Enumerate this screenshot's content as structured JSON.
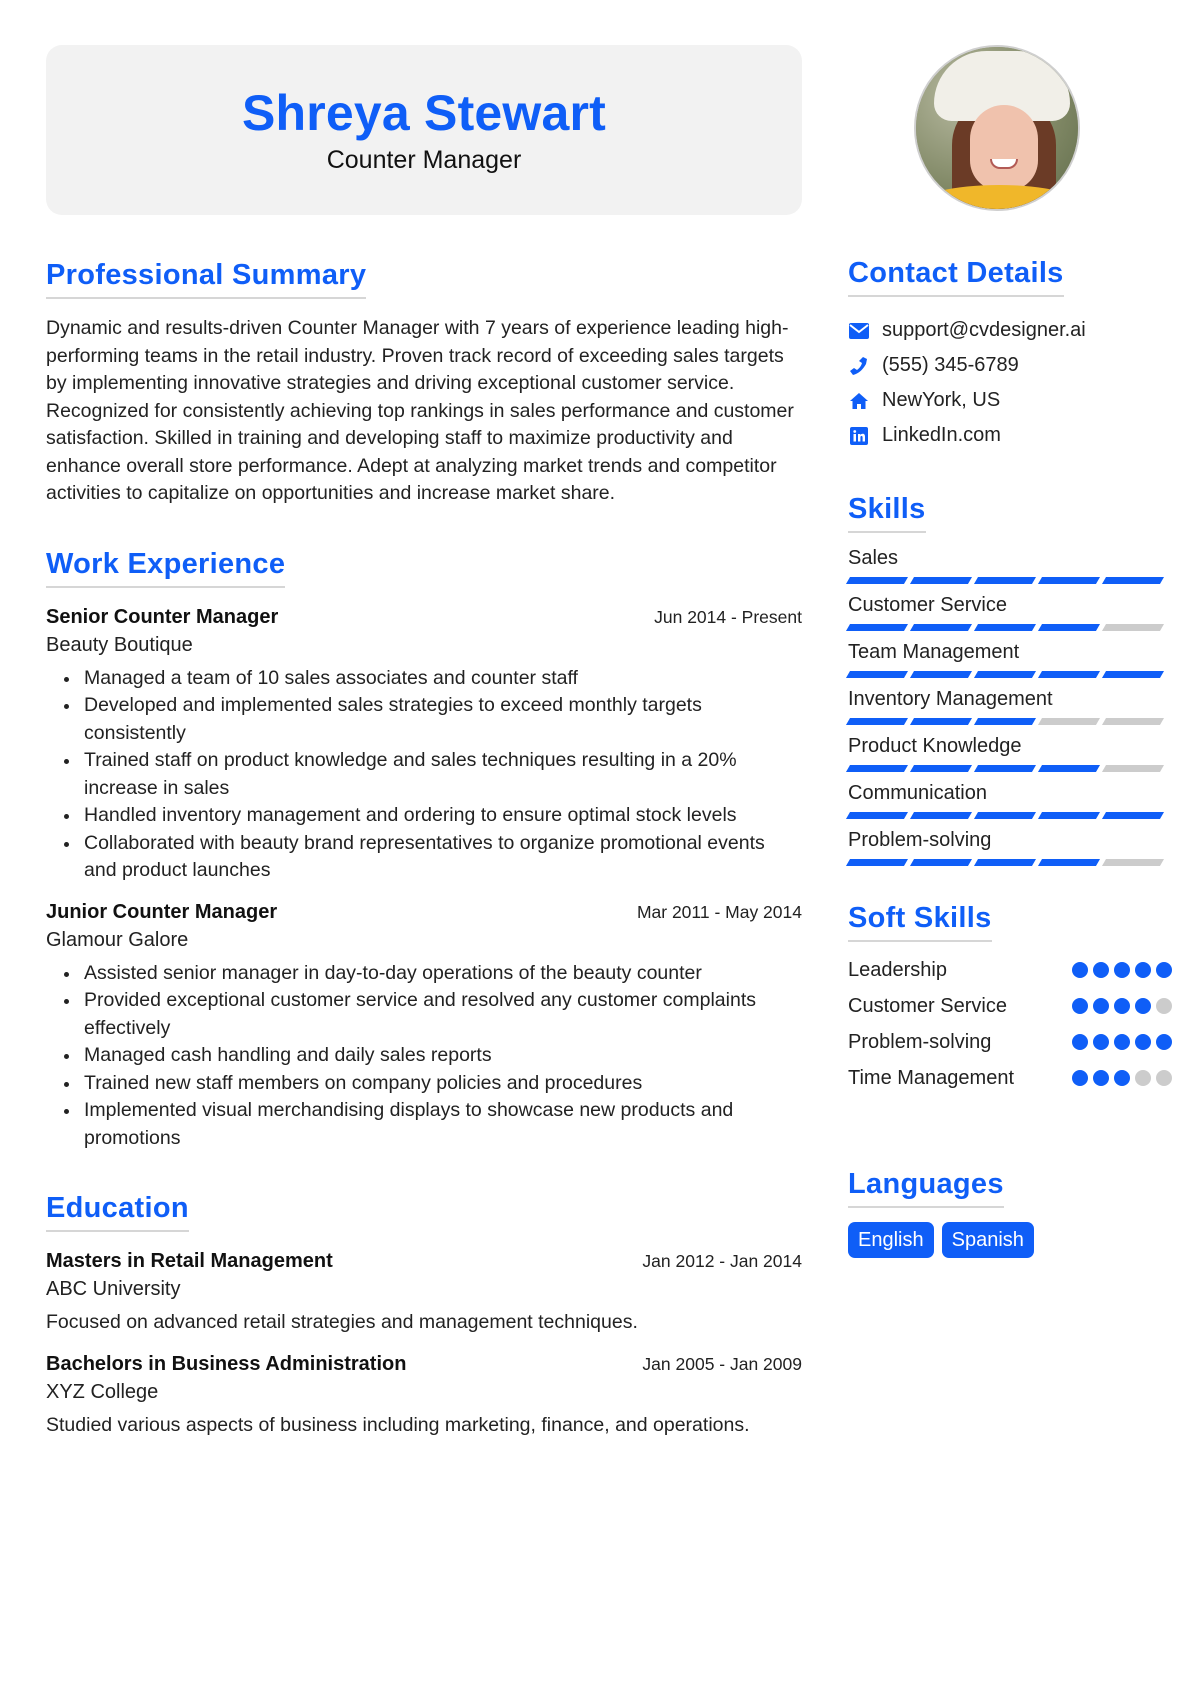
{
  "header": {
    "name": "Shreya Stewart",
    "title": "Counter Manager"
  },
  "summary": {
    "heading": "Professional Summary",
    "text": "Dynamic and results-driven Counter Manager with 7 years of experience leading high-performing teams in the retail industry. Proven track record of exceeding sales targets by implementing innovative strategies and driving exceptional customer service. Recognized for consistently achieving top rankings in sales performance and customer satisfaction. Skilled in training and developing staff to maximize productivity and enhance overall store performance. Adept at analyzing market trends and competitor activities to capitalize on opportunities and increase market share."
  },
  "experience": {
    "heading": "Work Experience",
    "jobs": [
      {
        "title": "Senior Counter Manager",
        "company": "Beauty Boutique",
        "date": "Jun 2014 - Present",
        "bullets": [
          "Managed a team of 10 sales associates and counter staff",
          "Developed and implemented sales strategies to exceed monthly targets consistently",
          "Trained staff on product knowledge and sales techniques resulting in a 20% increase in sales",
          "Handled inventory management and ordering to ensure optimal stock levels",
          "Collaborated with beauty brand representatives to organize promotional events and product launches"
        ]
      },
      {
        "title": "Junior Counter Manager",
        "company": "Glamour Galore",
        "date": "Mar 2011 - May 2014",
        "bullets": [
          "Assisted senior manager in day-to-day operations of the beauty counter",
          "Provided exceptional customer service and resolved any customer complaints effectively",
          "Managed cash handling and daily sales reports",
          "Trained new staff members on company policies and procedures",
          "Implemented visual merchandising displays to showcase new products and promotions"
        ]
      }
    ]
  },
  "education": {
    "heading": "Education",
    "items": [
      {
        "degree": "Masters in Retail Management",
        "school": "ABC University",
        "date": "Jan 2012 - Jan 2014",
        "description": "Focused on advanced retail strategies and management techniques."
      },
      {
        "degree": "Bachelors in Business Administration",
        "school": "XYZ College",
        "date": "Jan 2005 - Jan 2009",
        "description": "Studied various aspects of business including marketing, finance, and operations."
      }
    ]
  },
  "contact": {
    "heading": "Contact Details",
    "items": [
      {
        "icon": "envelope-icon",
        "text": "support@cvdesigner.ai"
      },
      {
        "icon": "phone-icon",
        "text": "(555) 345-6789"
      },
      {
        "icon": "home-icon",
        "text": "NewYork, US"
      },
      {
        "icon": "linkedin-icon",
        "text": "LinkedIn.com"
      }
    ]
  },
  "skills": {
    "heading": "Skills",
    "max": 5,
    "items": [
      {
        "name": "Sales",
        "level": 5
      },
      {
        "name": "Customer Service",
        "level": 4
      },
      {
        "name": "Team Management",
        "level": 5
      },
      {
        "name": "Inventory Management",
        "level": 3
      },
      {
        "name": "Product Knowledge",
        "level": 4
      },
      {
        "name": "Communication",
        "level": 5
      },
      {
        "name": "Problem-solving",
        "level": 4
      }
    ]
  },
  "soft_skills": {
    "heading": "Soft Skills",
    "max": 5,
    "items": [
      {
        "name": "Leadership",
        "level": 5
      },
      {
        "name": "Customer Service",
        "level": 4
      },
      {
        "name": "Problem-solving",
        "level": 5
      },
      {
        "name": "Time Management",
        "level": 3
      }
    ]
  },
  "languages": {
    "heading": "Languages",
    "items": [
      "English",
      "Spanish"
    ]
  },
  "colors": {
    "accent": "#0f5ef7",
    "inactive": "#cccccc",
    "header_bg": "#f2f2f2"
  }
}
